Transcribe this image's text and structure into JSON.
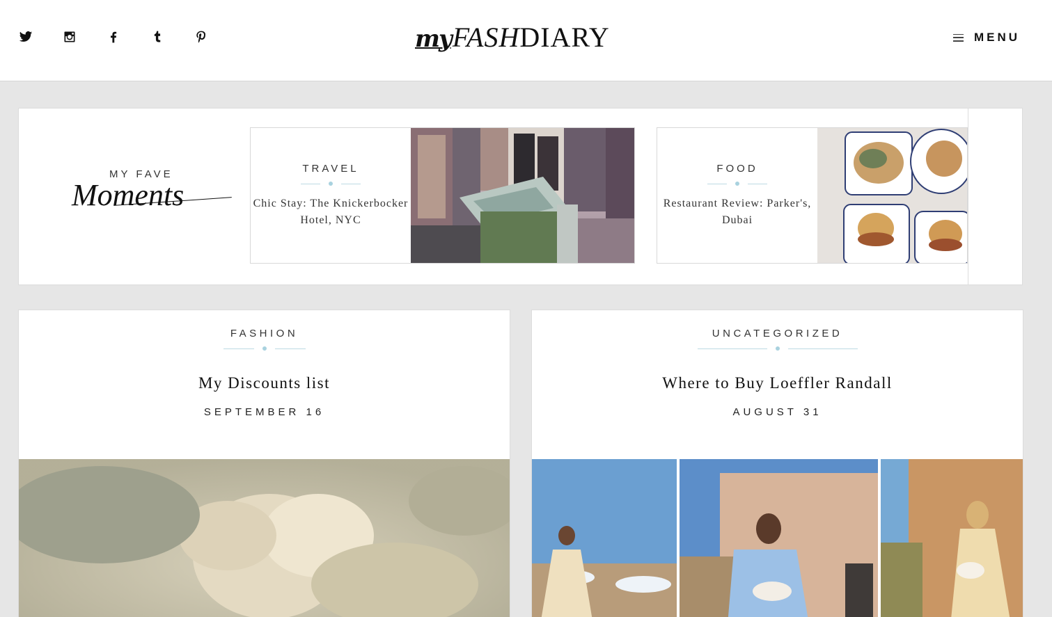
{
  "header": {
    "social": [
      {
        "icon": "twitter-icon"
      },
      {
        "icon": "instagram-icon"
      },
      {
        "icon": "facebook-icon"
      },
      {
        "icon": "tumblr-icon"
      },
      {
        "icon": "pinterest-icon"
      }
    ],
    "logo": {
      "part1": "my",
      "part2": "FASH",
      "part3": "DIARY"
    },
    "menu_label": "MENU"
  },
  "fave": {
    "label_top": "MY FAVE",
    "label_script": "Moments",
    "cards": [
      {
        "category": "TRAVEL",
        "title": "Chic Stay: The Knickerbocker Hotel, NYC"
      },
      {
        "category": "FOOD",
        "title": "Restaurant Review: Parker's, Dubai"
      }
    ]
  },
  "posts": [
    {
      "category": "FASHION",
      "title": "My Discounts list",
      "date": "SEPTEMBER 16"
    },
    {
      "category": "UNCATEGORIZED",
      "title": "Where to Buy Loeffler Randall",
      "date": "AUGUST 31"
    }
  ],
  "colors": {
    "accent": "#a9d2df",
    "background": "#e6e6e6"
  }
}
